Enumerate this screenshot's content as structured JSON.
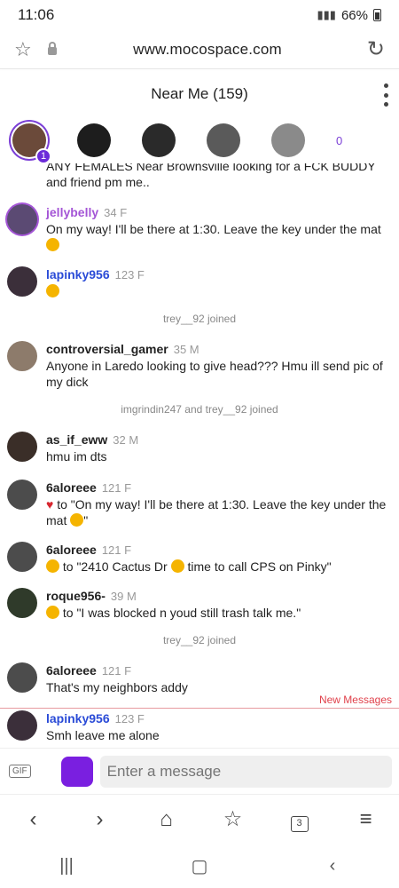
{
  "status": {
    "time": "11:06",
    "battery": "66%"
  },
  "browser": {
    "url": "www.mocospace.com"
  },
  "room": {
    "title": "Near Me (159)",
    "badge": "1",
    "count": "0"
  },
  "messages": [
    {
      "username": "",
      "meta": "",
      "text": "ANY FEMALES Near Brownsville looking for a FCK BUDDY and friend pm me..",
      "color": "#222"
    },
    {
      "username": "jellybelly",
      "meta": "34 F",
      "text": "On my way! I'll be there at 1:30. Leave the key under the mat",
      "color": "#a455d6"
    },
    {
      "username": "lapinky956",
      "meta": "123 F",
      "text": "",
      "color": "#2a4bd7"
    },
    {
      "system": "trey__92 joined"
    },
    {
      "username": "controversial_gamer",
      "meta": "35 M",
      "text": "Anyone in Laredo looking to give head??? Hmu ill send pic of my dick",
      "color": "#222"
    },
    {
      "system": "imgrindin247 and trey__92 joined"
    },
    {
      "username": "as_if_eww",
      "meta": "32 M",
      "text": "hmu im dts",
      "color": "#222"
    },
    {
      "username": "6aloreee",
      "meta": "121 F",
      "text": "to \"On my way! I'll be there at 1:30. Leave the key under the mat",
      "text_tail": "\"",
      "color": "#222"
    },
    {
      "username": "6aloreee",
      "meta": "121 F",
      "text": "to \"2410 Cactus Dr",
      "text_tail": "time to call CPS on Pinky\"",
      "color": "#222"
    },
    {
      "username": "roque956-",
      "meta": "39 M",
      "text": "to \"I was blocked n youd still trash talk me.\"",
      "color": "#222"
    },
    {
      "system": "trey__92 joined"
    },
    {
      "username": "6aloreee",
      "meta": "121 F",
      "text": "That's my neighbors addy",
      "color": "#222"
    },
    {
      "username": "lapinky956",
      "meta": "123 F",
      "text": "Smh leave me alone",
      "color": "#2a4bd7"
    }
  ],
  "new_messages_label": "New Messages",
  "compose": {
    "gif_label": "GIF",
    "placeholder": "Enter a message"
  },
  "browserbar": {
    "tabs_count": "3"
  },
  "icons": {
    "star": "star-icon",
    "lock": "lock-icon",
    "reload": "reload-icon",
    "menu": "kebab-menu-icon",
    "back": "back-icon",
    "forward": "forward-icon",
    "home": "home-icon",
    "bookmarks": "bookmarks-icon",
    "tabs": "tabs-icon",
    "hamburger": "menu-icon"
  },
  "colors": {
    "accent": "#7b3fd6",
    "blue_name": "#2a4bd7",
    "purple_name": "#a455d6",
    "new_message": "#e0414b"
  }
}
